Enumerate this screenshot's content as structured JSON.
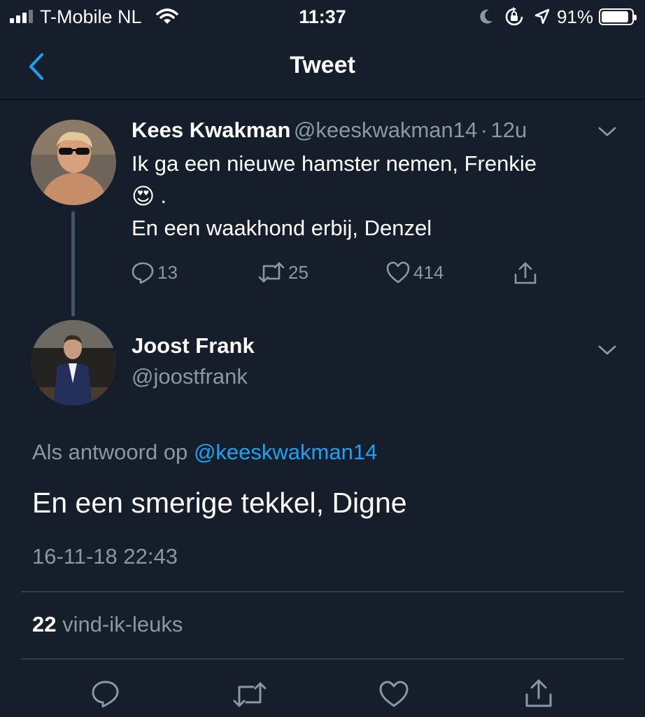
{
  "status_bar": {
    "carrier": "T-Mobile NL",
    "time": "11:37",
    "battery_percent": "91%",
    "battery_level": 0.91,
    "icons": [
      "signal-icon",
      "wifi-icon",
      "moon-icon",
      "orientation-lock-icon",
      "location-icon",
      "battery-icon"
    ]
  },
  "nav": {
    "title": "Tweet",
    "back_icon": "back-chevron-icon"
  },
  "original_tweet": {
    "author_name": "Kees Kwakman",
    "author_handle": "@keeskwakman14",
    "separator": "·",
    "age": "12u",
    "line1": "Ik ga een nieuwe hamster nemen, Frenkie",
    "emoji": "😍",
    "line2_suffix": ".",
    "line3": "En een waakhond erbij, Denzel",
    "replies": "13",
    "retweets": "25",
    "likes": "414"
  },
  "reply_tweet": {
    "author_name": "Joost Frank",
    "author_handle": "@joostfrank",
    "reply_to_label": "Als antwoord op",
    "reply_to_handle": "@keeskwakman14",
    "text": "En een smerige tekkel, Digne",
    "timestamp": "16-11-18 22:43",
    "likes_count": "22",
    "likes_label": "vind-ik-leuks"
  },
  "colors": {
    "background": "#151e2a",
    "muted": "#8899a6",
    "accent": "#1da1f2",
    "divider": "#2f3e4c"
  }
}
